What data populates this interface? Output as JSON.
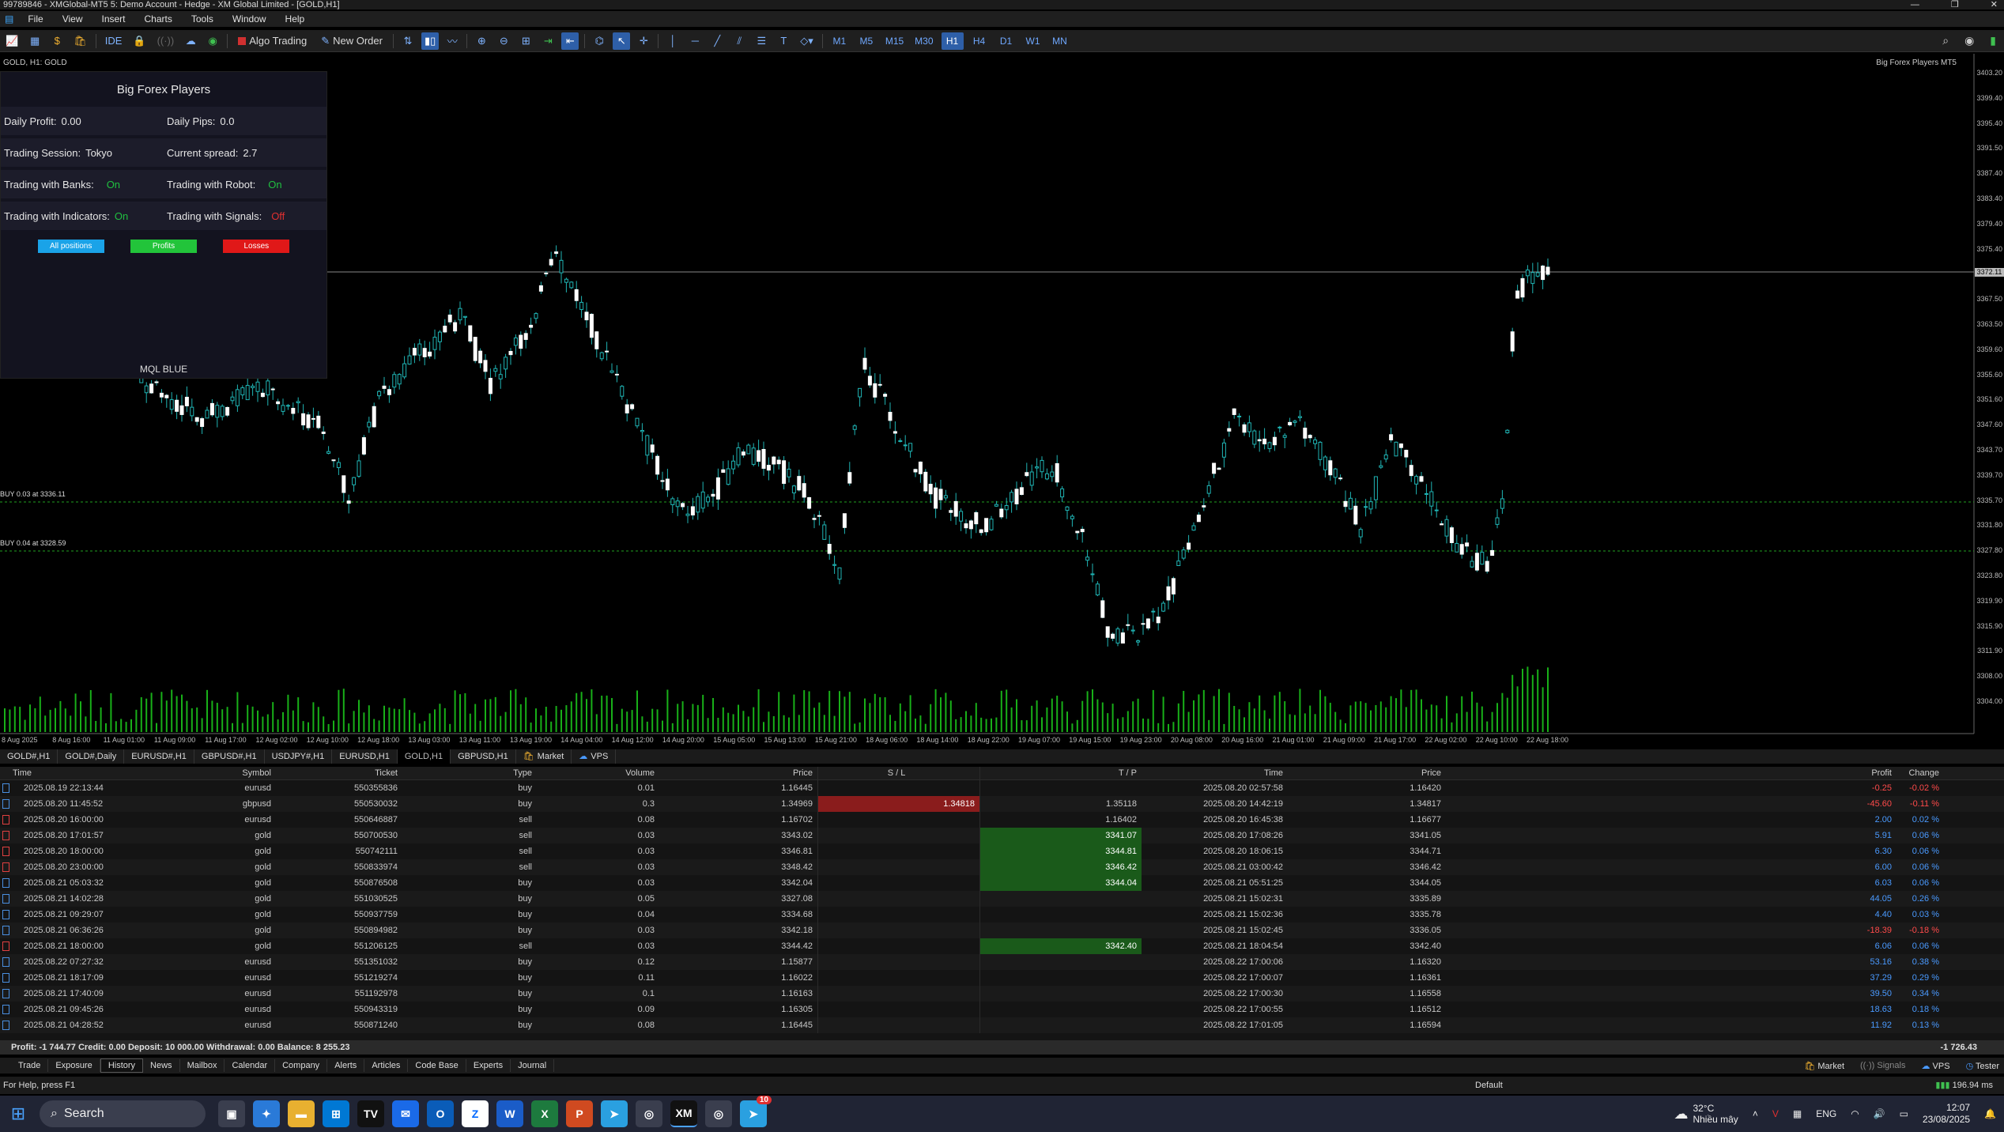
{
  "window": {
    "title": "99789846 - XMGlobal-MT5 5: Demo Account - Hedge - XM Global Limited - [GOLD,H1]",
    "btn_min": "—",
    "btn_max": "❐",
    "btn_close": "✕"
  },
  "menu": [
    "File",
    "View",
    "Insert",
    "Charts",
    "Tools",
    "Window",
    "Help"
  ],
  "toolbar": {
    "ide": "IDE",
    "algo": "Algo Trading",
    "neworder": "New Order",
    "timeframes": [
      "M1",
      "M5",
      "M15",
      "M30",
      "H1",
      "H4",
      "D1",
      "W1",
      "MN"
    ],
    "active_tf": "H1"
  },
  "chart": {
    "symbol_label": "GOLD, H1:  GOLD",
    "ea_name": "Big Forex Players MT5",
    "line1": "BUY 0.03 at 3336.11",
    "line2": "BUY 0.04 at 3328.59",
    "price_labels": [
      "3403.20",
      "3399.40",
      "3395.40",
      "3391.50",
      "3387.40",
      "3383.40",
      "3379.40",
      "3375.40",
      "3371.50",
      "3367.50",
      "3363.50",
      "3359.60",
      "3355.60",
      "3351.60",
      "3347.60",
      "3343.70",
      "3339.70",
      "3335.70",
      "3331.80",
      "3327.80",
      "3323.80",
      "3319.90",
      "3315.90",
      "3311.90",
      "3308.00",
      "3304.00"
    ],
    "time_labels": [
      "8 Aug 2025",
      "8 Aug 16:00",
      "11 Aug 01:00",
      "11 Aug 09:00",
      "11 Aug 17:00",
      "12 Aug 02:00",
      "12 Aug 10:00",
      "12 Aug 18:00",
      "13 Aug 03:00",
      "13 Aug 11:00",
      "13 Aug 19:00",
      "14 Aug 04:00",
      "14 Aug 12:00",
      "14 Aug 20:00",
      "15 Aug 05:00",
      "15 Aug 13:00",
      "15 Aug 21:00",
      "18 Aug 06:00",
      "18 Aug 14:00",
      "18 Aug 22:00",
      "19 Aug 07:00",
      "19 Aug 15:00",
      "19 Aug 23:00",
      "20 Aug 08:00",
      "20 Aug 16:00",
      "21 Aug 01:00",
      "21 Aug 09:00",
      "21 Aug 17:00",
      "22 Aug 02:00",
      "22 Aug 10:00",
      "22 Aug 18:00"
    ],
    "current_price_label": "3372.11"
  },
  "panel": {
    "title": "Big Forex Players",
    "daily_profit_label": "Daily Profit:",
    "daily_profit": "0.00",
    "daily_pips_label": "Daily Pips:",
    "daily_pips": "0.0",
    "session_label": "Trading Session:",
    "session": "Tokyo",
    "spread_label": "Current spread:",
    "spread": "2.7",
    "banks_label": "Trading with Banks:",
    "banks": "On",
    "robot_label": "Trading with Robot:",
    "robot": "On",
    "indicators_label": "Trading with Indicators:",
    "indicators": "On",
    "signals_label": "Trading with Signals:",
    "signals": "Off",
    "btn_all": "All positions",
    "btn_profits": "Profits",
    "btn_losses": "Losses",
    "brand": "MQL BLUE",
    "colors": {
      "all": "#1aa3e8",
      "profits": "#22c43a",
      "losses": "#e01818"
    }
  },
  "chart_tabs": [
    "GOLD#,H1",
    "GOLD#,Daily",
    "EURUSD#,H1",
    "GBPUSD#,H1",
    "USDJPY#,H1",
    "EURUSD,H1",
    "GOLD,H1",
    "GBPUSD,H1",
    "Market",
    "VPS"
  ],
  "active_chart_tab": "GOLD,H1",
  "table": {
    "headers": [
      "Time",
      "Symbol",
      "Ticket",
      "Type",
      "Volume",
      "Price",
      "S / L",
      "T / P",
      "Time",
      "Price",
      "Profit",
      "Change"
    ],
    "rows": [
      {
        "time": "2025.08.19 22:13:44",
        "symbol": "eurusd",
        "ticket": "550355836",
        "type": "buy",
        "volume": "0.01",
        "price": "1.16445",
        "sl": "",
        "tp": "",
        "ctime": "2025.08.20 02:57:58",
        "cprice": "1.16420",
        "profit": "-0.25",
        "change": "-0.02 %"
      },
      {
        "time": "2025.08.20 11:45:52",
        "symbol": "gbpusd",
        "ticket": "550530032",
        "type": "buy",
        "volume": "0.3",
        "price": "1.34969",
        "sl": "1.34818",
        "tp": "1.35118",
        "ctime": "2025.08.20 14:42:19",
        "cprice": "1.34817",
        "profit": "-45.60",
        "change": "-0.11 %"
      },
      {
        "time": "2025.08.20 16:00:00",
        "symbol": "eurusd",
        "ticket": "550646887",
        "type": "sell",
        "volume": "0.08",
        "price": "1.16702",
        "sl": "",
        "tp": "1.16402",
        "ctime": "2025.08.20 16:45:38",
        "cprice": "1.16677",
        "profit": "2.00",
        "change": "0.02 %"
      },
      {
        "time": "2025.08.20 17:01:57",
        "symbol": "gold",
        "ticket": "550700530",
        "type": "sell",
        "volume": "0.03",
        "price": "3343.02",
        "sl": "",
        "tp": "3341.07",
        "ctime": "2025.08.20 17:08:26",
        "cprice": "3341.05",
        "profit": "5.91",
        "change": "0.06 %"
      },
      {
        "time": "2025.08.20 18:00:00",
        "symbol": "gold",
        "ticket": "550742111",
        "type": "sell",
        "volume": "0.03",
        "price": "3346.81",
        "sl": "",
        "tp": "3344.81",
        "ctime": "2025.08.20 18:06:15",
        "cprice": "3344.71",
        "profit": "6.30",
        "change": "0.06 %"
      },
      {
        "time": "2025.08.20 23:00:00",
        "symbol": "gold",
        "ticket": "550833974",
        "type": "sell",
        "volume": "0.03",
        "price": "3348.42",
        "sl": "",
        "tp": "3346.42",
        "ctime": "2025.08.21 03:00:42",
        "cprice": "3346.42",
        "profit": "6.00",
        "change": "0.06 %"
      },
      {
        "time": "2025.08.21 05:03:32",
        "symbol": "gold",
        "ticket": "550876508",
        "type": "buy",
        "volume": "0.03",
        "price": "3342.04",
        "sl": "",
        "tp": "3344.04",
        "ctime": "2025.08.21 05:51:25",
        "cprice": "3344.05",
        "profit": "6.03",
        "change": "0.06 %"
      },
      {
        "time": "2025.08.21 14:02:28",
        "symbol": "gold",
        "ticket": "551030525",
        "type": "buy",
        "volume": "0.05",
        "price": "3327.08",
        "sl": "",
        "tp": "",
        "ctime": "2025.08.21 15:02:31",
        "cprice": "3335.89",
        "profit": "44.05",
        "change": "0.26 %"
      },
      {
        "time": "2025.08.21 09:29:07",
        "symbol": "gold",
        "ticket": "550937759",
        "type": "buy",
        "volume": "0.04",
        "price": "3334.68",
        "sl": "",
        "tp": "",
        "ctime": "2025.08.21 15:02:36",
        "cprice": "3335.78",
        "profit": "4.40",
        "change": "0.03 %"
      },
      {
        "time": "2025.08.21 06:36:26",
        "symbol": "gold",
        "ticket": "550894982",
        "type": "buy",
        "volume": "0.03",
        "price": "3342.18",
        "sl": "",
        "tp": "",
        "ctime": "2025.08.21 15:02:45",
        "cprice": "3336.05",
        "profit": "-18.39",
        "change": "-0.18 %"
      },
      {
        "time": "2025.08.21 18:00:00",
        "symbol": "gold",
        "ticket": "551206125",
        "type": "sell",
        "volume": "0.03",
        "price": "3344.42",
        "sl": "",
        "tp": "3342.40",
        "ctime": "2025.08.21 18:04:54",
        "cprice": "3342.40",
        "profit": "6.06",
        "change": "0.06 %"
      },
      {
        "time": "2025.08.22 07:27:32",
        "symbol": "eurusd",
        "ticket": "551351032",
        "type": "buy",
        "volume": "0.12",
        "price": "1.15877",
        "sl": "",
        "tp": "",
        "ctime": "2025.08.22 17:00:06",
        "cprice": "1.16320",
        "profit": "53.16",
        "change": "0.38 %"
      },
      {
        "time": "2025.08.21 18:17:09",
        "symbol": "eurusd",
        "ticket": "551219274",
        "type": "buy",
        "volume": "0.11",
        "price": "1.16022",
        "sl": "",
        "tp": "",
        "ctime": "2025.08.22 17:00:07",
        "cprice": "1.16361",
        "profit": "37.29",
        "change": "0.29 %"
      },
      {
        "time": "2025.08.21 17:40:09",
        "symbol": "eurusd",
        "ticket": "551192978",
        "type": "buy",
        "volume": "0.1",
        "price": "1.16163",
        "sl": "",
        "tp": "",
        "ctime": "2025.08.22 17:00:30",
        "cprice": "1.16558",
        "profit": "39.50",
        "change": "0.34 %"
      },
      {
        "time": "2025.08.21 09:45:26",
        "symbol": "eurusd",
        "ticket": "550943319",
        "type": "buy",
        "volume": "0.09",
        "price": "1.16305",
        "sl": "",
        "tp": "",
        "ctime": "2025.08.22 17:00:55",
        "cprice": "1.16512",
        "profit": "18.63",
        "change": "0.18 %"
      },
      {
        "time": "2025.08.21 04:28:52",
        "symbol": "eurusd",
        "ticket": "550871240",
        "type": "buy",
        "volume": "0.08",
        "price": "1.16445",
        "sl": "",
        "tp": "",
        "ctime": "2025.08.22 17:01:05",
        "cprice": "1.16594",
        "profit": "11.92",
        "change": "0.13 %"
      }
    ]
  },
  "summary": {
    "text": "Profit: -1 744.77  Credit: 0.00  Deposit: 10 000.00  Withdrawal: 0.00  Balance: 8 255.23",
    "total": "-1 726.43"
  },
  "bottom_tabs": [
    "Trade",
    "Exposure",
    "History",
    "News",
    "Mailbox",
    "Calendar",
    "Company",
    "Alerts",
    "Articles",
    "Code Base",
    "Experts",
    "Journal"
  ],
  "active_bottom_tab": "History",
  "bottom_right": [
    "Market",
    "Signals",
    "VPS",
    "Tester"
  ],
  "status": {
    "help": "For Help, press F1",
    "profile": "Default",
    "ping": "196.94 ms"
  },
  "taskbar": {
    "search": "Search",
    "weather_temp": "32°C",
    "weather_desc": "Nhiều mây",
    "lang": "ENG",
    "time": "12:07",
    "date": "23/08/2025",
    "badge": "10"
  }
}
